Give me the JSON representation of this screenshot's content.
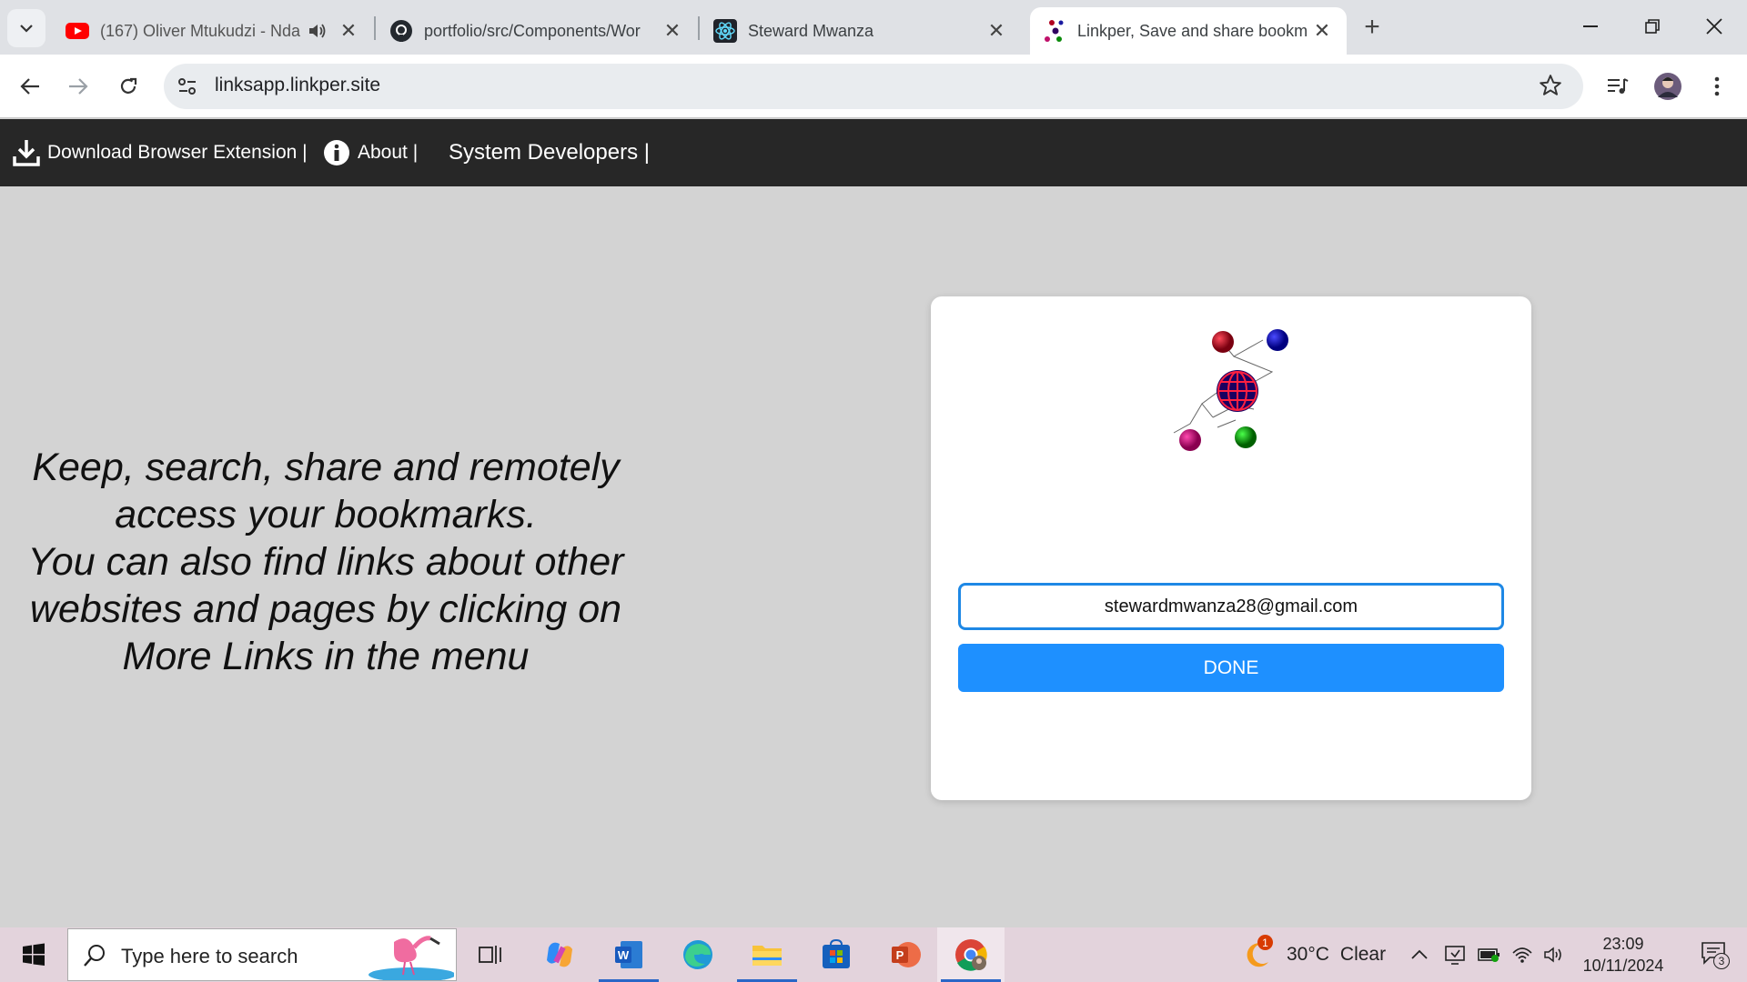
{
  "browser": {
    "tabs": [
      {
        "title": "(167) Oliver Mtukudzi - Nda",
        "icon": "youtube-icon",
        "audio": true
      },
      {
        "title": "portfolio/src/Components/Wor",
        "icon": "github-icon"
      },
      {
        "title": "Steward Mwanza",
        "icon": "react-icon"
      },
      {
        "title": "Linkper, Save and share bookm",
        "icon": "linkper-icon",
        "active": true
      }
    ],
    "url": "linksapp.linkper.site"
  },
  "site_nav": {
    "download": "Download Browser Extension |",
    "about": "About |",
    "developers": "System Developers |"
  },
  "hero": {
    "line1": "Keep, search, share and remotely access your bookmarks.",
    "line2": "You can also find links about other websites and pages by clicking on More Links in the menu"
  },
  "form": {
    "email_value": "stewardmwanza28@gmail.com",
    "done_label": "DONE"
  },
  "taskbar": {
    "search_placeholder": "Type here to search",
    "weather_temp": "30°C",
    "weather_desc": "Clear",
    "weather_badge": "1",
    "time": "23:09",
    "date": "10/11/2024",
    "notification_count": "3"
  },
  "colors": {
    "accent": "#1e90ff",
    "navbar": "#272727",
    "page_bg": "#d3d3d3"
  }
}
